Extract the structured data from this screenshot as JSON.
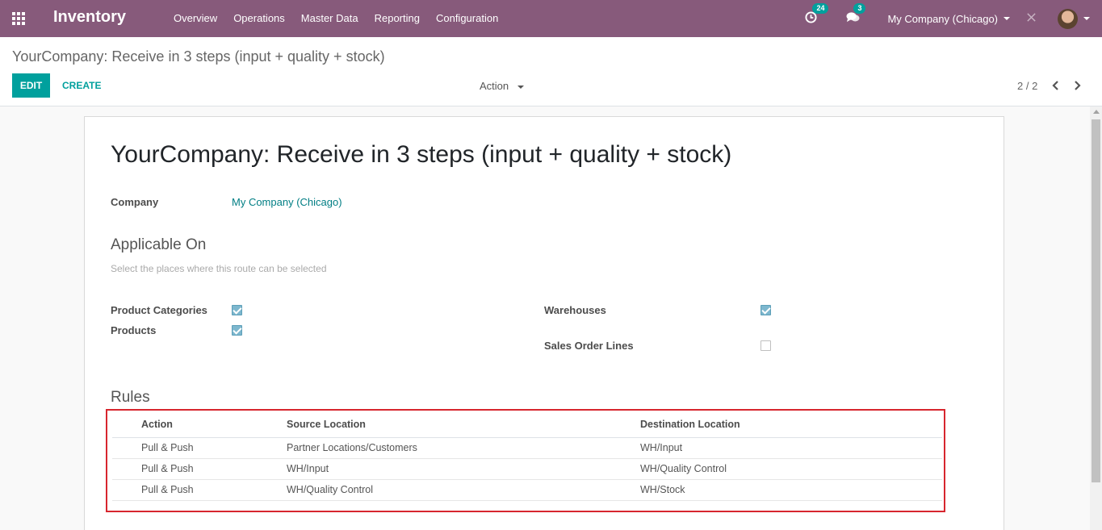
{
  "navbar": {
    "brand": "Inventory",
    "menu": [
      "Overview",
      "Operations",
      "Master Data",
      "Reporting",
      "Configuration"
    ],
    "activity_count": "24",
    "message_count": "3",
    "company": "My Company (Chicago)"
  },
  "control_panel": {
    "breadcrumb": "YourCompany: Receive in 3 steps (input + quality + stock)",
    "edit_label": "EDIT",
    "create_label": "CREATE",
    "action_label": "Action",
    "pager": "2 / 2"
  },
  "form": {
    "title": "YourCompany: Receive in 3 steps (input + quality + stock)",
    "company_label": "Company",
    "company_value": "My Company (Chicago)",
    "applicable_title": "Applicable On",
    "applicable_help": "Select the places where this route can be selected",
    "product_categories_label": "Product Categories",
    "product_categories_checked": true,
    "products_label": "Products",
    "products_checked": true,
    "warehouses_label": "Warehouses",
    "warehouses_checked": true,
    "sale_lines_label": "Sales Order Lines",
    "sale_lines_checked": false,
    "rules_title": "Rules",
    "rules_headers": [
      "Action",
      "Source Location",
      "Destination Location"
    ],
    "rules": [
      [
        "Pull & Push",
        "Partner Locations/Customers",
        "WH/Input"
      ],
      [
        "Pull & Push",
        "WH/Input",
        "WH/Quality Control"
      ],
      [
        "Pull & Push",
        "WH/Quality Control",
        "WH/Stock"
      ]
    ]
  },
  "colors": {
    "navbar": "#875a7b",
    "primary": "#00a09d",
    "highlight": "#d7262e"
  }
}
